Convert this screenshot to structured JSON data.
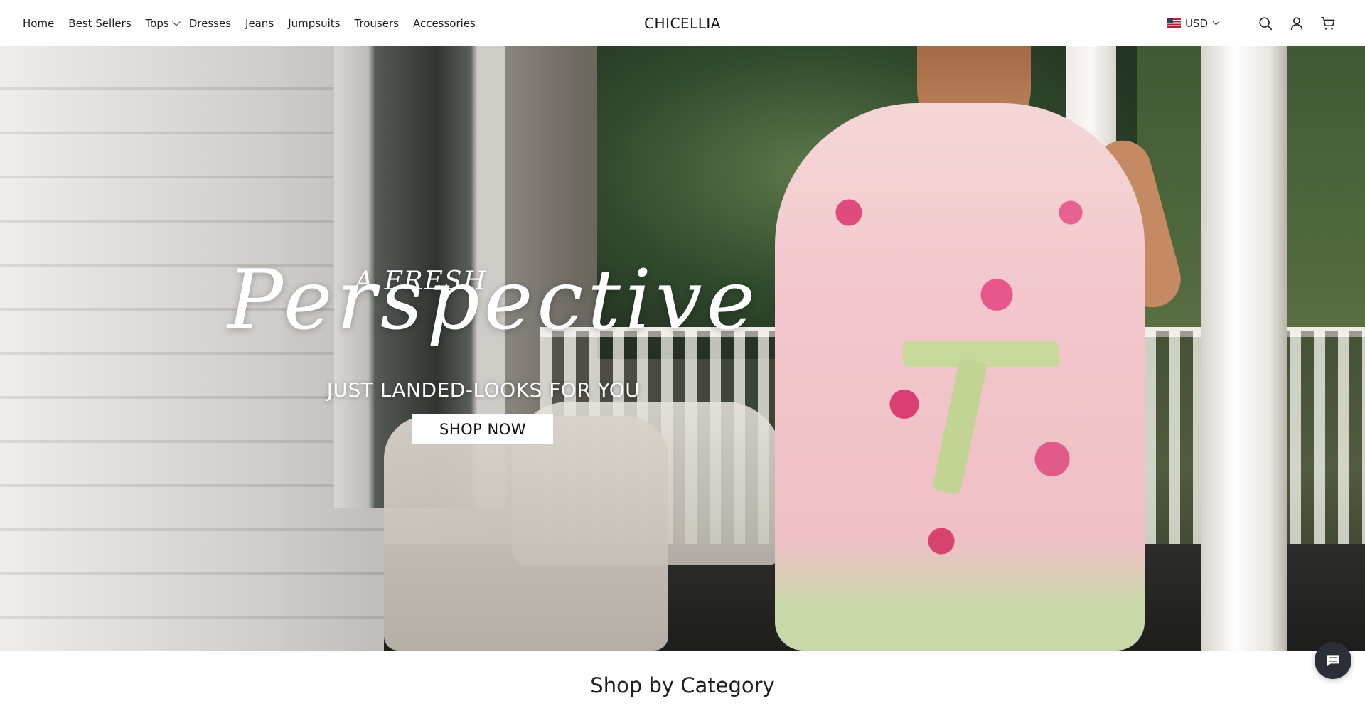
{
  "store": {
    "name": "CHICELLIA"
  },
  "nav": {
    "items": [
      {
        "label": "Home"
      },
      {
        "label": "Best Sellers"
      },
      {
        "label": "Tops",
        "has_dropdown": true
      },
      {
        "label": "Dresses"
      },
      {
        "label": "Jeans"
      },
      {
        "label": "Jumpsuits"
      },
      {
        "label": "Trousers"
      },
      {
        "label": "Accessories"
      }
    ]
  },
  "header_tools": {
    "currency": "USD",
    "currency_flag": "us-flag-icon",
    "icons": [
      "search-icon",
      "account-icon",
      "cart-icon"
    ]
  },
  "hero": {
    "line_small": "A FRESH",
    "line_script": "Perspective",
    "subtitle": "JUST LANDED-LOOKS FOR YOU",
    "cta_label": "SHOP NOW"
  },
  "section": {
    "title": "Shop by Category"
  },
  "chat": {
    "icon": "chat-icon"
  },
  "colors": {
    "chat_bg": "#2a2e36",
    "button_bg": "#ffffff",
    "hero_text": "#ffffff"
  }
}
